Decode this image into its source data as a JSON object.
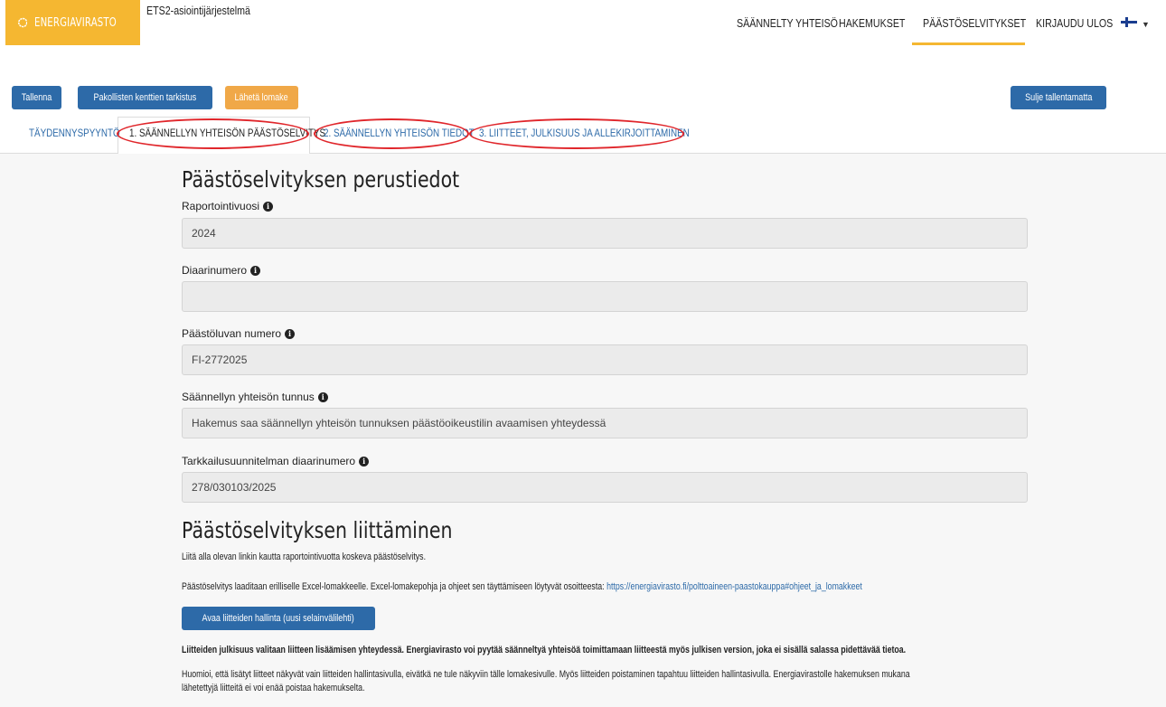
{
  "header": {
    "logo_text": "ENERGIAVIRASTO",
    "system_name": "ETS2-asiointijärjestelmä",
    "nav": [
      {
        "label": "SÄÄNNELTY YHTEISÖ"
      },
      {
        "label": "HAKEMUKSET"
      },
      {
        "label": "PÄÄSTÖSELVITYKSET",
        "active": true
      },
      {
        "label": "KIRJAUDU ULOS"
      }
    ],
    "language_icon": "finnish-flag-icon",
    "brand_color": "#f5b731"
  },
  "toolbar": {
    "save_label": "Tallenna",
    "check_label": "Pakollisten kenttien tarkistus",
    "send_label": "Lähetä lomake",
    "close_label": "Sulje tallentamatta"
  },
  "tabs": [
    {
      "label": "TÄYDENNYSPYYNTÖ"
    },
    {
      "label": "1. SÄÄNNELLYN YHTEISÖN PÄÄSTÖSELVITYS",
      "active": true
    },
    {
      "label": "2. SÄÄNNELLYN YHTEISÖN TIEDOT"
    },
    {
      "label": "3. LIITTEET, JULKISUUS JA ALLEKIRJOITTAMINEN"
    }
  ],
  "basics": {
    "title": "Päästöselvityksen perustiedot",
    "fields": [
      {
        "label": "Raportointivuosi",
        "value": ""
      },
      {
        "label": "Diaarinumero",
        "value": ""
      },
      {
        "label": "Päästöluvan numero",
        "value": "FI-2772025"
      },
      {
        "label": "Säännellyn yhteisön tunnus",
        "value": "Hakemus saa säännellyn yhteisön tunnuksen päästöoikeustilin avaamisen yhteydessä"
      },
      {
        "label": "Tarkkailusuunnitelman diaarinumero",
        "value": "278/030103/2025"
      }
    ],
    "year_value": "2024"
  },
  "attach": {
    "title": "Päästöselvityksen liittäminen",
    "intro": "Liitä alla olevan linkin kautta raportointivuotta koskeva päästöselvitys.",
    "excel_text": "Päästöselvitys laaditaan erilliselle Excel-lomakkeelle. Excel-lomakepohja ja ohjeet sen täyttämiseen löytyvät osoitteesta:",
    "excel_link": "https://energiavirasto.fi/polttoaineen-paastokauppa#ohjeet_ja_lomakkeet",
    "open_button": "Avaa liitteiden hallinta (uusi selainvälilehti)",
    "publicity_note": "Liitteiden julkisuus valitaan liitteen lisäämisen yhteydessä. Energiavirasto voi pyytää säänneltyä yhteisöä toimittamaan liitteestä myös julkisen version, joka ei sisällä salassa pidettävää tietoa.",
    "note_line1": "Huomioi, että lisätyt liitteet näkyvät vain liitteiden hallintasivulla, eivätkä ne tule näkyviin tälle lomakesivulle. Myös liitteiden poistaminen tapahtuu liitteiden hallintasivulla. Energiavirastolle hakemuksen mukana",
    "note_line2": "lähetettyjä liitteitä ei voi enää poistaa hakemukselta."
  }
}
